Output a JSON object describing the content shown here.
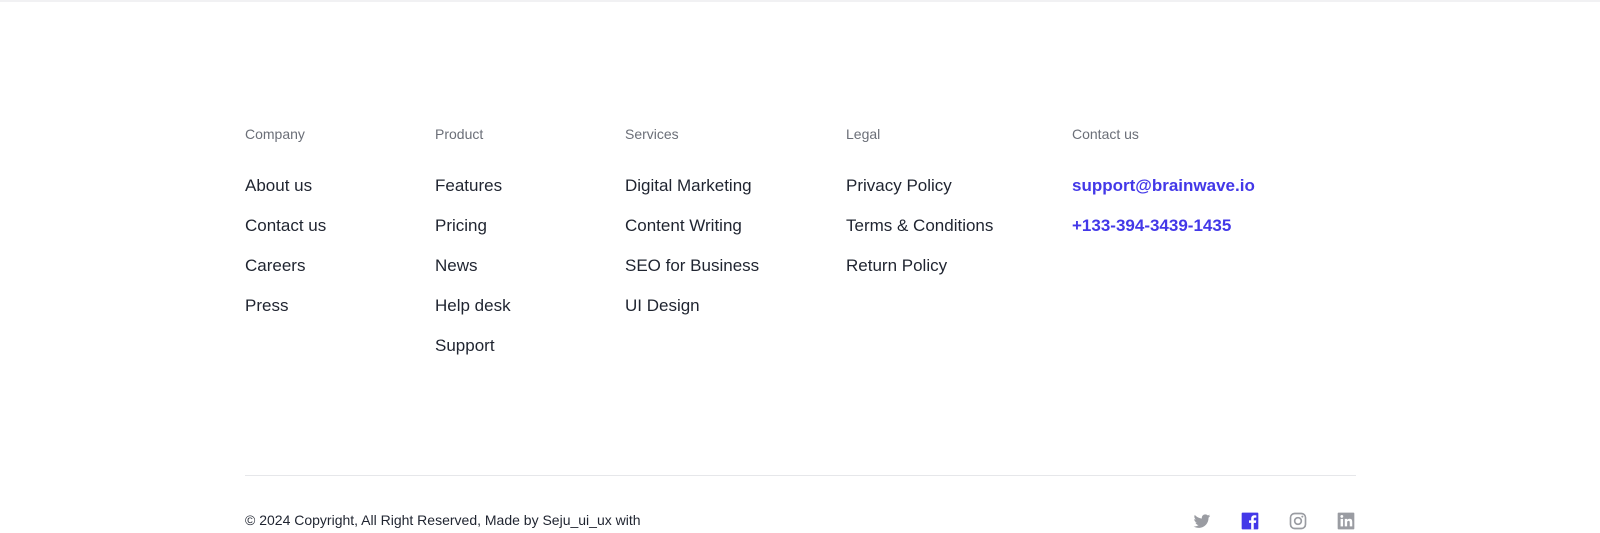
{
  "columns": [
    {
      "title": "Company",
      "items": [
        "About us",
        "Contact us",
        "Careers",
        "Press"
      ]
    },
    {
      "title": "Product",
      "items": [
        "Features",
        "Pricing",
        "News",
        "Help desk",
        "Support"
      ]
    },
    {
      "title": "Services",
      "items": [
        "Digital Marketing",
        "Content Writing",
        "SEO for Business",
        "UI Design"
      ]
    },
    {
      "title": "Legal",
      "items": [
        "Privacy Policy",
        "Terms & Conditions",
        "Return Policy"
      ]
    },
    {
      "title": "Contact us",
      "items": [
        "support@brainwave.io",
        "+133-394-3439-1435"
      ]
    }
  ],
  "copyright": "© 2024 Copyright, All Right Reserved, Made by Seju_ui_ux with",
  "social": [
    {
      "icon": "twitter-icon",
      "color": "#9a9ca2"
    },
    {
      "icon": "facebook-icon",
      "color": "#4338e8"
    },
    {
      "icon": "instagram-icon",
      "color": "#9a9ca2"
    },
    {
      "icon": "linkedin-icon",
      "color": "#9a9ca2"
    }
  ],
  "colors": {
    "accent": "#4338e8",
    "text": "#1f2430",
    "muted": "#6b6f78"
  }
}
